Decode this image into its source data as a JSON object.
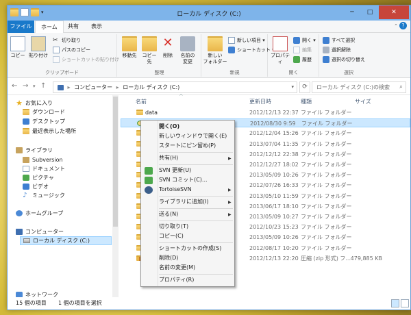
{
  "window": {
    "title": "ローカル ディスク (C:)",
    "minimize": "─",
    "maximize": "□",
    "close": "✕"
  },
  "tabs": {
    "file": "ファイル",
    "home": "ホーム",
    "share": "共有",
    "view": "表示"
  },
  "ribbon": {
    "clipboard": {
      "label": "クリップボード",
      "copy": "コピー",
      "paste": "貼り付け",
      "cut": "切り取り",
      "copy_path": "パスのコピー",
      "paste_shortcut": "ショートカットの貼り付け"
    },
    "organize": {
      "label": "整理",
      "move_to": "移動先",
      "copy_to": "コピー先",
      "delete": "削除",
      "rename": "名前の\n変更"
    },
    "new": {
      "label": "新規",
      "new_folder": "新しい\nフォルダー",
      "new_item": "新しい項目 ▾",
      "shortcut": "ショートカット ▾"
    },
    "open": {
      "label": "開く",
      "properties": "プロパティ",
      "open": "開く ▾",
      "edit": "編集",
      "history": "履歴"
    },
    "select": {
      "label": "選択",
      "select_all": "すべて選択",
      "select_none": "選択解除",
      "invert": "選択の切り替え"
    }
  },
  "address": {
    "path": [
      "コンピューター",
      "ローカル ディスク (C:)"
    ],
    "search_placeholder": "ローカル ディスク (C:)の検索"
  },
  "nav": {
    "favorites": "お気に入り",
    "downloads": "ダウンロード",
    "desktop": "デスクトップ",
    "recent": "最近表示した場所",
    "libraries": "ライブラリ",
    "subversion": "Subversion",
    "documents": "ドキュメント",
    "pictures": "ピクチャ",
    "videos": "ビデオ",
    "music": "ミュージック",
    "homegroup": "ホームグループ",
    "computer": "コンピューター",
    "local_disk": "ローカル ディスク (C:)",
    "network": "ネットワーク"
  },
  "columns": {
    "name": "名前",
    "date": "更新日時",
    "type": "種類",
    "size": "サイズ"
  },
  "files": [
    {
      "name": "data",
      "date": "2012/12/13 22:37",
      "type": "ファイル フォルダー",
      "size": ""
    },
    {
      "name": "Develop",
      "date": "2012/08/30 9:59",
      "type": "ファイル フォルダー",
      "size": ""
    },
    {
      "name": "De",
      "date": "2012/12/04 15:26",
      "type": "ファイル フォルダー",
      "size": ""
    },
    {
      "name": "De",
      "date": "2013/07/04 11:35",
      "type": "ファイル フォルダー",
      "size": ""
    },
    {
      "name": "de",
      "date": "2012/12/12 22:38",
      "type": "ファイル フォルダー",
      "size": ""
    },
    {
      "name": "go",
      "date": "2012/12/27 18:02",
      "type": "ファイル フォルダー",
      "size": ""
    },
    {
      "name": "Mi",
      "date": "2013/05/09 10:26",
      "type": "ファイル フォルダー",
      "size": ""
    },
    {
      "name": "Pe",
      "date": "2012/07/26 16:33",
      "type": "ファイル フォルダー",
      "size": ""
    },
    {
      "name": "Pr",
      "date": "2013/05/10 11:59",
      "type": "ファイル フォルダー",
      "size": ""
    },
    {
      "name": "Pr",
      "date": "2013/06/17 18:10",
      "type": "ファイル フォルダー",
      "size": ""
    },
    {
      "name": "Pr",
      "date": "2013/05/09 10:27",
      "type": "ファイル フォルダー",
      "size": ""
    },
    {
      "name": "to",
      "date": "2012/10/23 15:23",
      "type": "ファイル フォルダー",
      "size": ""
    },
    {
      "name": "W",
      "date": "2013/05/09 10:26",
      "type": "ファイル フォルダー",
      "size": ""
    },
    {
      "name": "ユ",
      "date": "2012/08/17 10:20",
      "type": "ファイル フォルダー",
      "size": ""
    },
    {
      "name": "de",
      "date": "2012/12/13 22:20",
      "type": "圧縮 (zip 形式) フ...",
      "size": "479,885 KB"
    }
  ],
  "status": {
    "count": "15 個の項目",
    "selected": "1 個の項目を選択"
  },
  "context_menu": {
    "open": "開く(O)",
    "open_new_window": "新しいウィンドウで開く(E)",
    "pin_start": "スタートにピン留め(P)",
    "share": "共有(H)",
    "svn_update": "SVN 更新(U)",
    "svn_commit": "SVN コミット(C)...",
    "tortoise": "TortoiseSVN",
    "add_library": "ライブラリに追加(I)",
    "send_to": "送る(N)",
    "cut": "切り取り(T)",
    "copy": "コピー(C)",
    "create_shortcut": "ショートカットの作成(S)",
    "delete": "削除(D)",
    "rename": "名前の変更(M)",
    "properties": "プロパティ(R)"
  },
  "colors": {
    "title_bar": "#7eb4ea",
    "file_tab": "#1979ca",
    "selection": "#cce8ff",
    "close": "#c7453a"
  }
}
